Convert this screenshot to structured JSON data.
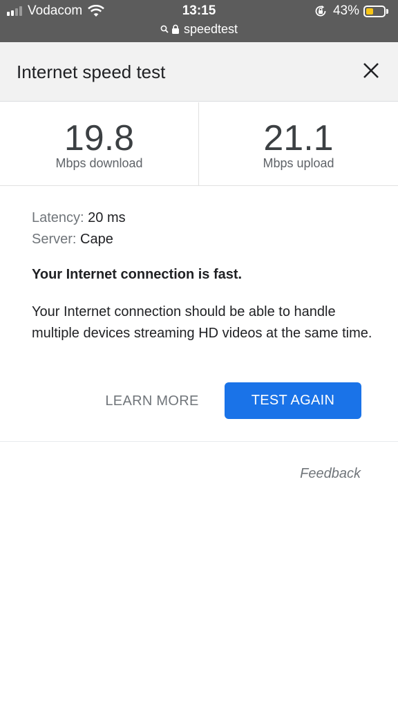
{
  "status_bar": {
    "carrier": "Vodacom",
    "time": "13:15",
    "battery_percent": "43%",
    "battery_level": 0.43,
    "signal_bars_active": 2,
    "signal_bars_total": 4,
    "url": "speedtest",
    "icons": [
      "signal-icon",
      "wifi-icon",
      "rotation-lock-icon",
      "battery-icon",
      "search-icon",
      "lock-icon"
    ]
  },
  "dialog": {
    "title": "Internet speed test",
    "close_icon": "close-icon"
  },
  "results": {
    "download_value": "19.8",
    "download_label": "Mbps download",
    "upload_value": "21.1",
    "upload_label": "Mbps upload"
  },
  "details": {
    "latency_label": "Latency:",
    "latency_value": "20 ms",
    "server_label": "Server:",
    "server_value": "Cape",
    "verdict": "Your Internet connection is fast.",
    "description": "Your Internet connection should be able to handle multiple devices streaming HD videos at the same time."
  },
  "actions": {
    "learn_more": "LEARN MORE",
    "test_again": "TEST AGAIN",
    "feedback": "Feedback"
  },
  "colors": {
    "status_bar_bg": "#5c5c5c",
    "header_bg": "#f2f2f2",
    "primary_button": "#1a73e8",
    "battery_fill": "#f7c516"
  }
}
